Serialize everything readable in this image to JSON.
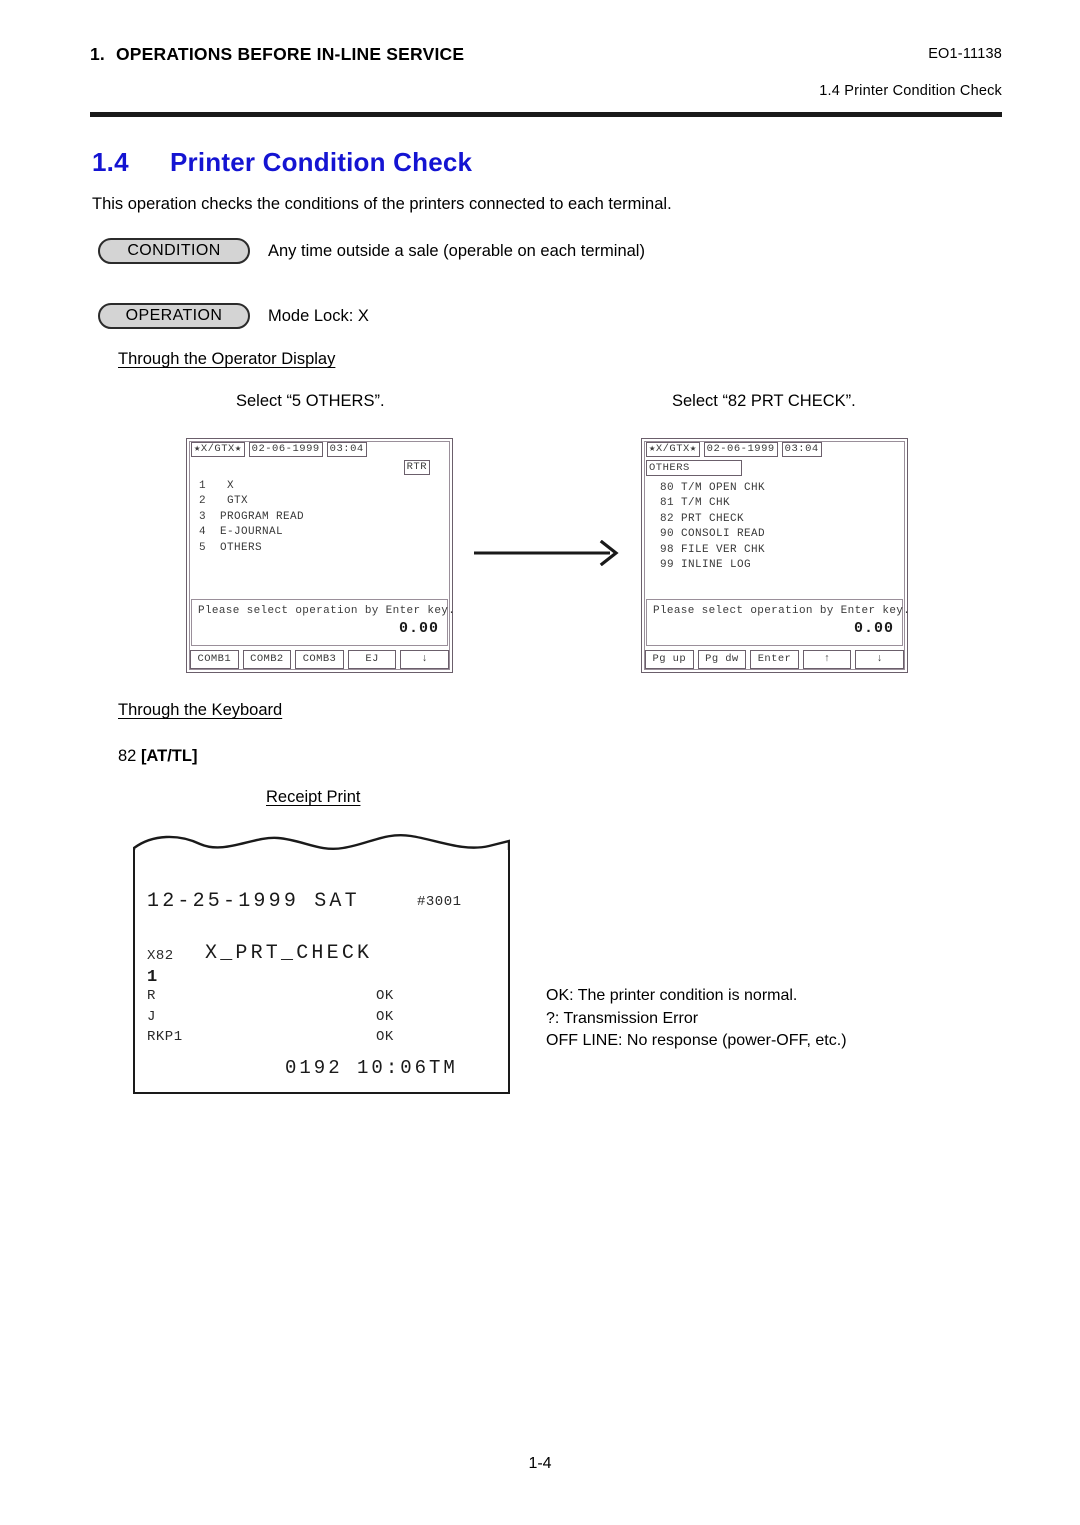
{
  "header": {
    "chapter_number": "1.",
    "chapter_title": "OPERATIONS BEFORE IN-LINE SERVICE",
    "doc_code": "EO1-11138",
    "running_head": "1.4  Printer Condition Check"
  },
  "section": {
    "number": "1.4",
    "title": "Printer Condition Check",
    "intro": "This operation checks the conditions of the printers connected to each terminal."
  },
  "callouts": {
    "condition_label": "CONDITION",
    "condition_text": "Any time outside a sale (operable on each terminal)",
    "operation_label": "OPERATION",
    "operation_text": "Mode Lock:  X"
  },
  "operator_display": {
    "heading": "Through the Operator Display",
    "step1_caption": "Select “5 OTHERS”.",
    "step2_caption": "Select “82 PRT CHECK”.",
    "screen1": {
      "status_mode": "★X/GTX★",
      "status_date": "02-06-1999",
      "status_time": "03:04",
      "indicator": "RTR",
      "menu": "1   X\n2   GTX\n3  PROGRAM READ\n4  E-JOURNAL\n5  OTHERS",
      "message": "Please select operation by Enter key.",
      "amount": "0.00",
      "function_keys": [
        "COMB1",
        "COMB2",
        "COMB3",
        "EJ",
        "↓"
      ]
    },
    "screen2": {
      "status_mode": "★X/GTX★",
      "status_date": "02-06-1999",
      "status_time": "03:04",
      "submenu_title": "OTHERS",
      "menu": "80 T/M OPEN CHK\n81 T/M CHK\n82 PRT CHECK\n90 CONSOLI READ\n98 FILE VER CHK\n99 INLINE LOG",
      "message": "Please select operation by Enter key.",
      "amount": "0.00",
      "function_keys": [
        "Pg up",
        "Pg dw",
        "Enter",
        "↑",
        "↓"
      ]
    }
  },
  "keyboard": {
    "heading": "Through the Keyboard",
    "command_code": "82 ",
    "command_key": "[AT/TL]"
  },
  "receipt": {
    "caption": "Receipt Print",
    "date_line": "12-25-1999 SAT",
    "terminal_no": "#3001",
    "report_code": "X82",
    "report_title": "X_PRT_CHECK",
    "line_no": "1",
    "rows": [
      {
        "name": "R",
        "status": "OK"
      },
      {
        "name": "J",
        "status": "OK"
      },
      {
        "name": "RKP1",
        "status": "OK"
      }
    ],
    "footer": "0192 10:06TM"
  },
  "legend": {
    "line1": "OK:  The printer condition is normal.",
    "line2": "?:  Transmission Error",
    "line3": "OFF LINE:  No response (power-OFF, etc.)"
  },
  "page_footer": "1-4",
  "colors": {
    "section_title": "#1414d2",
    "rule": "#1a1a1a",
    "pill_fill": "#d4d4d4",
    "lcd_border": "#6b5f6b"
  }
}
